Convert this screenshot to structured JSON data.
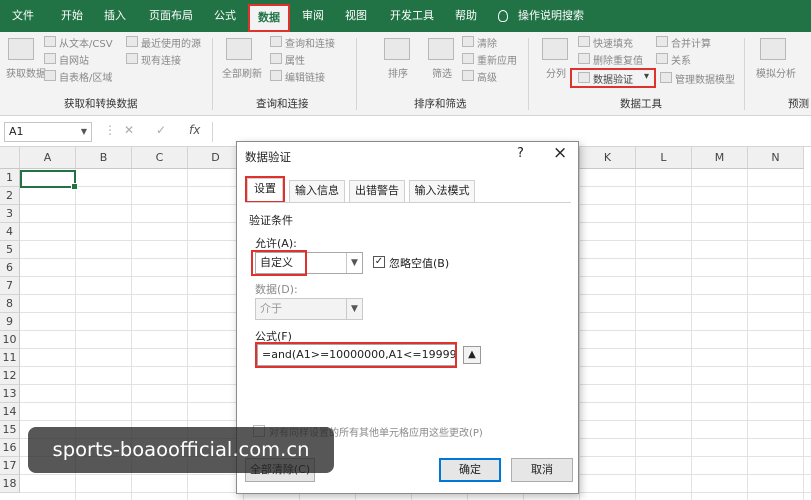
{
  "colors": {
    "ribbon_green": "#217346",
    "highlight_red": "#e0322d",
    "ok_blue": "#0078d7"
  },
  "ribbon_tabs": [
    "文件",
    "开始",
    "插入",
    "页面布局",
    "公式",
    "数据",
    "审阅",
    "视图",
    "开发工具",
    "帮助"
  ],
  "tell_me": "操作说明搜索",
  "ribbon": {
    "get_data": {
      "big_label": "获取数据",
      "items": [
        "从文本/CSV",
        "自网站",
        "自表格/区域"
      ],
      "items2": [
        "最近使用的源",
        "现有连接"
      ],
      "title": "获取和转换数据"
    },
    "queries": {
      "big_label": "全部刷新",
      "items": [
        "查询和连接",
        "属性",
        "编辑链接"
      ],
      "title": "查询和连接"
    },
    "sort": {
      "items": [
        "排序",
        "筛选"
      ],
      "side": [
        "清除",
        "重新应用",
        "高级"
      ],
      "title": "排序和筛选"
    },
    "tools": {
      "big_label": "分列",
      "items": [
        "快速填充",
        "删除重复值",
        "数据验证"
      ],
      "items2": [
        "合并计算",
        "关系",
        "管理数据模型"
      ],
      "title": "数据工具"
    },
    "forecast": {
      "big_label": "模拟分析",
      "title": "预测"
    }
  },
  "namebox": "A1",
  "formula_fx": "fx",
  "columns": [
    "A",
    "B",
    "C",
    "D",
    "E",
    "F",
    "G",
    "H",
    "I",
    "J",
    "K",
    "L",
    "M",
    "N"
  ],
  "rows": [
    "1",
    "2",
    "3",
    "4",
    "5",
    "6",
    "7",
    "8",
    "9",
    "10",
    "11",
    "12",
    "13",
    "14",
    "15",
    "16",
    "17",
    "18"
  ],
  "dialog": {
    "title": "数据验证",
    "help": "?",
    "close": "×",
    "tabs": [
      "设置",
      "输入信息",
      "出错警告",
      "输入法模式"
    ],
    "section": "验证条件",
    "allow_label": "允许(A):",
    "allow_value": "自定义",
    "ignore_blank": "忽略空值(B)",
    "data_label": "数据(D):",
    "data_value": "介于",
    "formula_label": "公式(F)",
    "formula_value": "=and(A1>=10000000,A1<=19999999)",
    "apply_all": "对有同样设置的所有其他单元格应用这些更改(P)",
    "clear_all": "全部清除(C)",
    "ok": "确定",
    "cancel": "取消"
  },
  "watermark": "sports-boaoofficial.com.cn"
}
